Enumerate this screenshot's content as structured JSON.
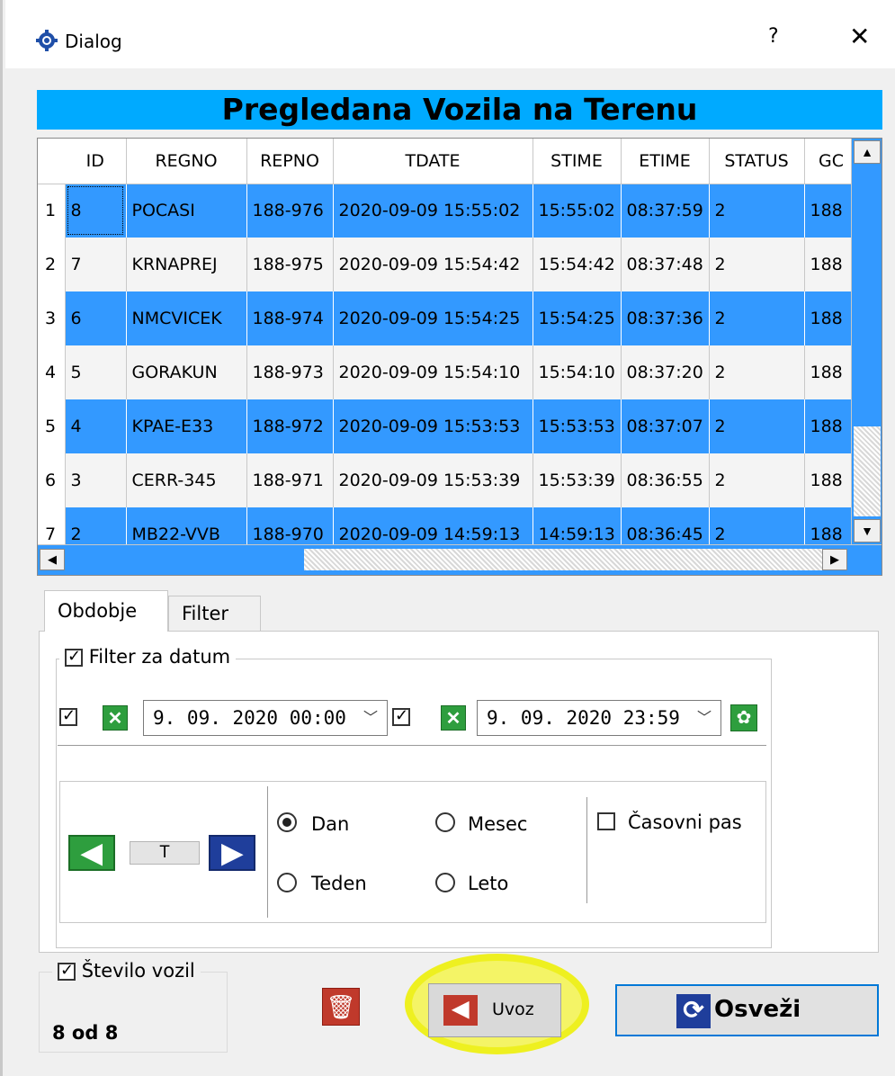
{
  "window": {
    "title": "Dialog",
    "help": "?",
    "close": "✕"
  },
  "banner": "Pregledana Vozila  na Terenu",
  "grid": {
    "columns": [
      "ID",
      "REGNO",
      "REPNO",
      "TDATE",
      "STIME",
      "ETIME",
      "STATUS",
      "GC"
    ],
    "rows": [
      {
        "n": "1",
        "cells": [
          "8",
          "POCASI",
          "188-976",
          "2020-09-09 15:55:02",
          "15:55:02",
          "08:37:59",
          "2",
          "188"
        ]
      },
      {
        "n": "2",
        "cells": [
          "7",
          "KRNAPREJ",
          "188-975",
          "2020-09-09 15:54:42",
          "15:54:42",
          "08:37:48",
          "2",
          "188"
        ]
      },
      {
        "n": "3",
        "cells": [
          "6",
          "NMCVICEK",
          "188-974",
          "2020-09-09 15:54:25",
          "15:54:25",
          "08:37:36",
          "2",
          "188"
        ]
      },
      {
        "n": "4",
        "cells": [
          "5",
          "GORAKUN",
          "188-973",
          "2020-09-09 15:54:10",
          "15:54:10",
          "08:37:20",
          "2",
          "188"
        ]
      },
      {
        "n": "5",
        "cells": [
          "4",
          "KPAE-E33",
          "188-972",
          "2020-09-09 15:53:53",
          "15:53:53",
          "08:37:07",
          "2",
          "188"
        ]
      },
      {
        "n": "6",
        "cells": [
          "3",
          "CERR-345",
          "188-971",
          "2020-09-09 15:53:39",
          "15:53:39",
          "08:36:55",
          "2",
          "188"
        ]
      },
      {
        "n": "7",
        "cells": [
          "2",
          "MB22-VVB",
          "188-970",
          "2020-09-09 14:59:13",
          "14:59:13",
          "08:36:45",
          "2",
          "188"
        ]
      }
    ]
  },
  "tabs": {
    "active": "Obdobje",
    "other": "Filter"
  },
  "date_filter": {
    "label": "Filter za datum",
    "from": "9. 09. 2020 00:00",
    "to": "9. 09. 2020 23:59"
  },
  "nav": {
    "today": "T"
  },
  "period": {
    "day": "Dan",
    "month": "Mesec",
    "week": "Teden",
    "year": "Leto",
    "timezone": "Časovni pas",
    "selected": "Dan"
  },
  "counter": {
    "label": "Število vozil",
    "value": "8 od 8"
  },
  "buttons": {
    "import": "Uvoz",
    "refresh": "Osveži"
  },
  "colors": {
    "banner": "#00aaff",
    "selection": "#3399ff",
    "highlight": "#f4f466"
  }
}
